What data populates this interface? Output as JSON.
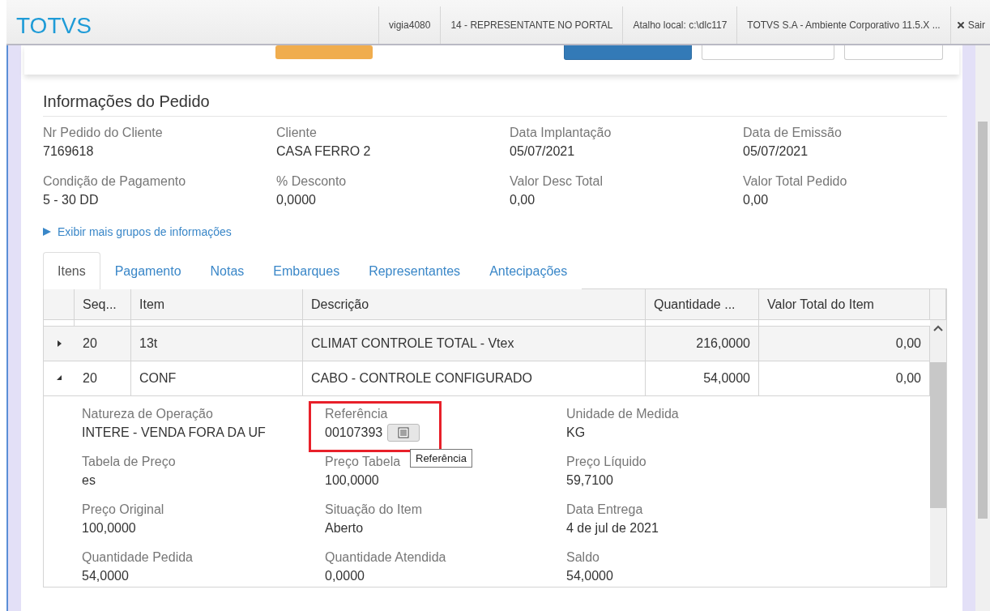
{
  "top_bar": {
    "logo": "TOTVS",
    "items": [
      "vigia4080",
      "14 - REPRESENTANTE NO PORTAL",
      "Atalho local: c:\\dlc117",
      "TOTVS S.A - Ambiente Corporativo 11.5.X ..."
    ],
    "exit_label": "Sair"
  },
  "order_info": {
    "title": "Informações do Pedido",
    "fields": [
      {
        "label": "Nr Pedido do Cliente",
        "value": "7169618"
      },
      {
        "label": "Cliente",
        "value": "CASA FERRO 2"
      },
      {
        "label": "Data Implantação",
        "value": "05/07/2021"
      },
      {
        "label": "Data de Emissão",
        "value": "05/07/2021"
      },
      {
        "label": "Condição de Pagamento",
        "value": "5 - 30 DD"
      },
      {
        "label": "% Desconto",
        "value": "0,0000"
      },
      {
        "label": "Valor Desc Total",
        "value": "0,00"
      },
      {
        "label": "Valor Total Pedido",
        "value": "0,00"
      }
    ],
    "more_link": "Exibir mais grupos de informações"
  },
  "tabs": [
    {
      "label": "Itens",
      "selected": true
    },
    {
      "label": "Pagamento",
      "selected": false
    },
    {
      "label": "Notas",
      "selected": false
    },
    {
      "label": "Embarques",
      "selected": false
    },
    {
      "label": "Representantes",
      "selected": false
    },
    {
      "label": "Antecipações",
      "selected": false
    }
  ],
  "table": {
    "columns": [
      "Seq...",
      "Item",
      "Descrição",
      "Quantidade ...",
      "Valor Total do Item"
    ],
    "rows": [
      {
        "expanded": false,
        "cells": [
          "20",
          "13t",
          "CLIMAT CONTROLE TOTAL - Vtex",
          "216,0000",
          "0,00"
        ]
      },
      {
        "expanded": true,
        "cells": [
          "20",
          "CONF",
          "CABO - CONTROLE CONFIGURADO",
          "54,0000",
          "0,00"
        ]
      }
    ],
    "detail_fields": [
      {
        "label": "Natureza de Operação",
        "value": "INTERE - VENDA FORA DA UF",
        "highlighted": false,
        "has_button": false
      },
      {
        "label": "Referência",
        "value": "00107393",
        "highlighted": true,
        "has_button": true
      },
      {
        "label": "Unidade de Medida",
        "value": "KG",
        "highlighted": false,
        "has_button": false
      },
      {
        "label": "Tabela de Preço",
        "value": "es",
        "highlighted": false,
        "has_button": false
      },
      {
        "label": "Preço Tabela",
        "value": "100,0000",
        "highlighted": false,
        "has_button": false
      },
      {
        "label": "Preço Líquido",
        "value": "59,7100",
        "highlighted": false,
        "has_button": false
      },
      {
        "label": "Preço Original",
        "value": "100,0000",
        "highlighted": false,
        "has_button": false
      },
      {
        "label": "Situação do Item",
        "value": "Aberto",
        "highlighted": false,
        "has_button": false
      },
      {
        "label": "Data Entrega",
        "value": "4 de jul de 2021",
        "highlighted": false,
        "has_button": false
      },
      {
        "label": "Quantidade Pedida",
        "value": "54,0000",
        "highlighted": false,
        "has_button": false
      },
      {
        "label": "Quantidade Atendida",
        "value": "0,0000",
        "highlighted": false,
        "has_button": false
      },
      {
        "label": "Saldo",
        "value": "54,0000",
        "highlighted": false,
        "has_button": false
      }
    ],
    "tooltip": "Referência"
  }
}
